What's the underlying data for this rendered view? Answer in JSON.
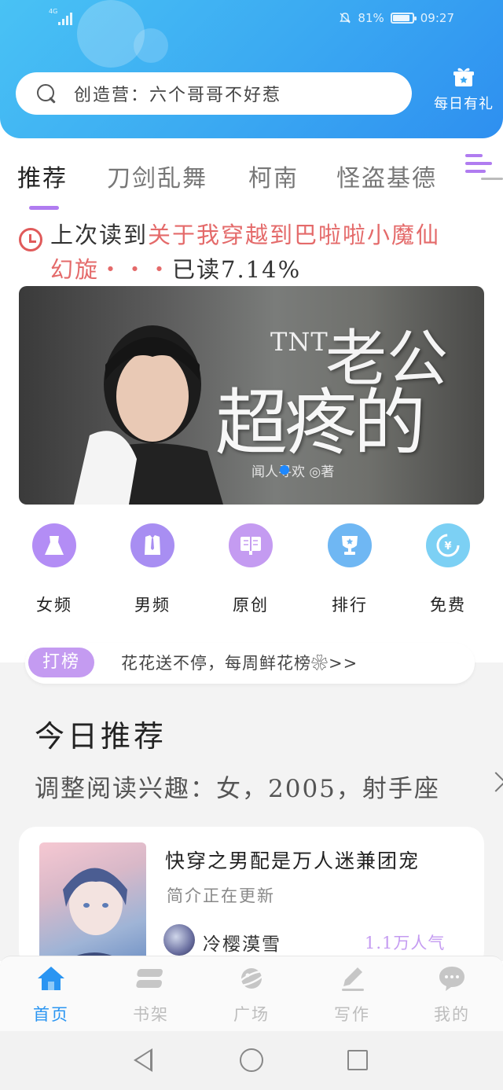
{
  "status_bar": {
    "network": "4G",
    "battery": "81%",
    "time": "09:27",
    "battery_level": 0.81
  },
  "header": {
    "search_placeholder": "创造营：六个哥哥不好惹",
    "gift_label": "每日有礼",
    "gradient_start": "#49c2f4",
    "gradient_end": "#2e8ff0"
  },
  "tabs": [
    {
      "label": "推荐",
      "active": true
    },
    {
      "label": "刀剑乱舞",
      "active": false
    },
    {
      "label": "柯南",
      "active": false
    },
    {
      "label": "怪盗基德",
      "active": false
    }
  ],
  "last_read": {
    "prefix": "上次读到",
    "book_part1": "关于我穿越到巴啦啦小魔仙",
    "book_part2": "幻旋・・・",
    "progress_text": "已读7.14%"
  },
  "banner": {
    "series": "TNT",
    "title_top": "老公",
    "title_main": "超疼的",
    "author": "闻人寻欢 ◎著",
    "active_slide": 1
  },
  "categories": [
    {
      "label": "女频",
      "icon": "dress-icon",
      "color": "#b38df5"
    },
    {
      "label": "男频",
      "icon": "shirt-icon",
      "color": "#a88ef2"
    },
    {
      "label": "原创",
      "icon": "book-icon",
      "color": "#c49bf1"
    },
    {
      "label": "排行",
      "icon": "trophy-icon",
      "color": "#6fb7f3"
    },
    {
      "label": "免费",
      "icon": "yen-coin-icon",
      "color": "#7cd0f4"
    }
  ],
  "rank_bar": {
    "badge": "打榜",
    "text": "花花送不停，每周鲜花榜❀>>"
  },
  "today": {
    "title": "今日推荐",
    "subtitle": "调整阅读兴趣：女，2005，射手座"
  },
  "book": {
    "title": "快穿之男配是万人迷兼团宠",
    "description": "简介正在更新",
    "author": "冷樱漠雪",
    "popularity": "1.1万人气"
  },
  "bottom_nav": [
    {
      "label": "首页",
      "icon": "home-icon",
      "active": true
    },
    {
      "label": "书架",
      "icon": "bookshelf-icon",
      "active": false
    },
    {
      "label": "广场",
      "icon": "planet-icon",
      "active": false
    },
    {
      "label": "写作",
      "icon": "pen-icon",
      "active": false
    },
    {
      "label": "我的",
      "icon": "chat-bubble-icon",
      "active": false
    }
  ],
  "colors": {
    "accent_purple": "#b07cf0",
    "accent_blue": "#2a95f2",
    "highlight_red": "#e46a6a"
  }
}
